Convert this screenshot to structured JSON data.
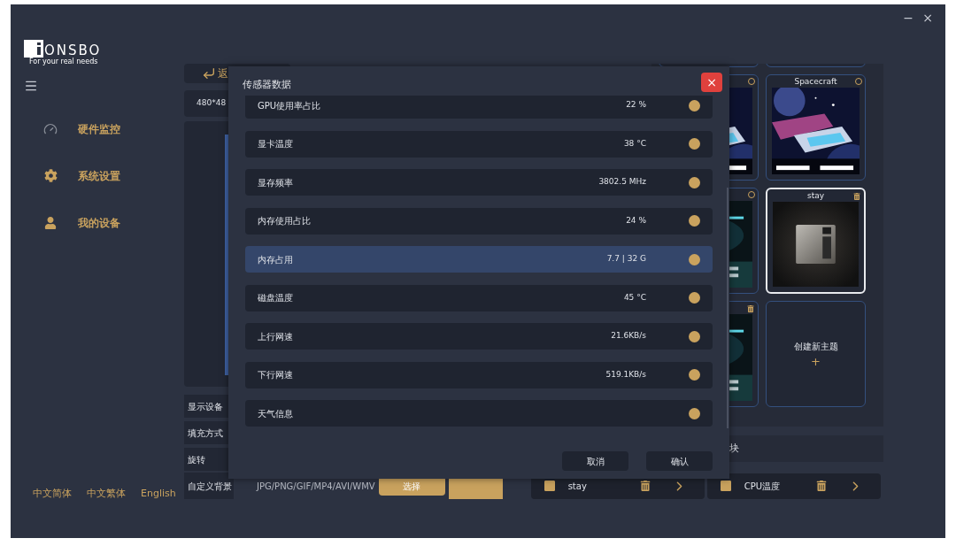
{
  "window_controls": [
    "−",
    "×"
  ],
  "sidebar": {
    "logo": {
      "word": "ONSBO",
      "tagline": "For your real needs"
    },
    "items": [
      {
        "kind": "gauge",
        "label": "硬件监控"
      },
      {
        "kind": "gear",
        "label": "系统设置"
      },
      {
        "kind": "user",
        "label": "我的设备"
      }
    ],
    "languages": [
      "中文简体",
      "中文繁体",
      "English"
    ]
  },
  "editor": {
    "back_button": "返",
    "resolution": "480*48",
    "settings": [
      "显示设备",
      "填充方式",
      "旋转"
    ],
    "background": {
      "label": "自定义背景",
      "formats": "JPG/PNG/GIF/MP4/AVI/WMV",
      "select_button": "选择"
    }
  },
  "themes": [
    {
      "kind": "theme",
      "selected": false
    },
    {
      "kind": "theme",
      "selected": false
    },
    {
      "kind": "theme",
      "deletable": false,
      "selected": false
    },
    {
      "kind": "theme",
      "title": "Spacecraft",
      "deletable": false,
      "selected": false
    },
    {
      "kind": "theme",
      "deletable": false,
      "selected": false
    },
    {
      "kind": "theme",
      "title": "stay",
      "deletable": true,
      "selected": true
    },
    {
      "kind": "theme",
      "deletable": true,
      "selected": false
    },
    {
      "kind": "create",
      "title": "创建新主题",
      "symbol": "+",
      "selected": false
    }
  ],
  "blocks": {
    "heading": "块",
    "items": [
      {
        "label": "stay",
        "checked": true
      },
      {
        "label": "CPU温度",
        "checked": true
      }
    ]
  },
  "sensor_dialog": {
    "title": "传感器数据",
    "close": "×",
    "rows": [
      {
        "label": "GPU使用率占比",
        "value": "22 %",
        "selected": false
      },
      {
        "label": "显卡温度",
        "value": "38 °C",
        "selected": false
      },
      {
        "label": "显存频率",
        "value": "3802.5 MHz",
        "selected": false
      },
      {
        "label": "内存使用占比",
        "value": "24 %",
        "selected": false
      },
      {
        "label": "内存占用",
        "value": "7.7 | 32 G",
        "selected": true
      },
      {
        "label": "磁盘温度",
        "value": "45 °C",
        "selected": false
      },
      {
        "label": "上行网速",
        "value": "21.6KB/s",
        "selected": false
      },
      {
        "label": "下行网速",
        "value": "519.1KB/s",
        "selected": false
      },
      {
        "label": "天气信息",
        "selected": false
      }
    ],
    "buttons": [
      "取消",
      "确认"
    ]
  }
}
